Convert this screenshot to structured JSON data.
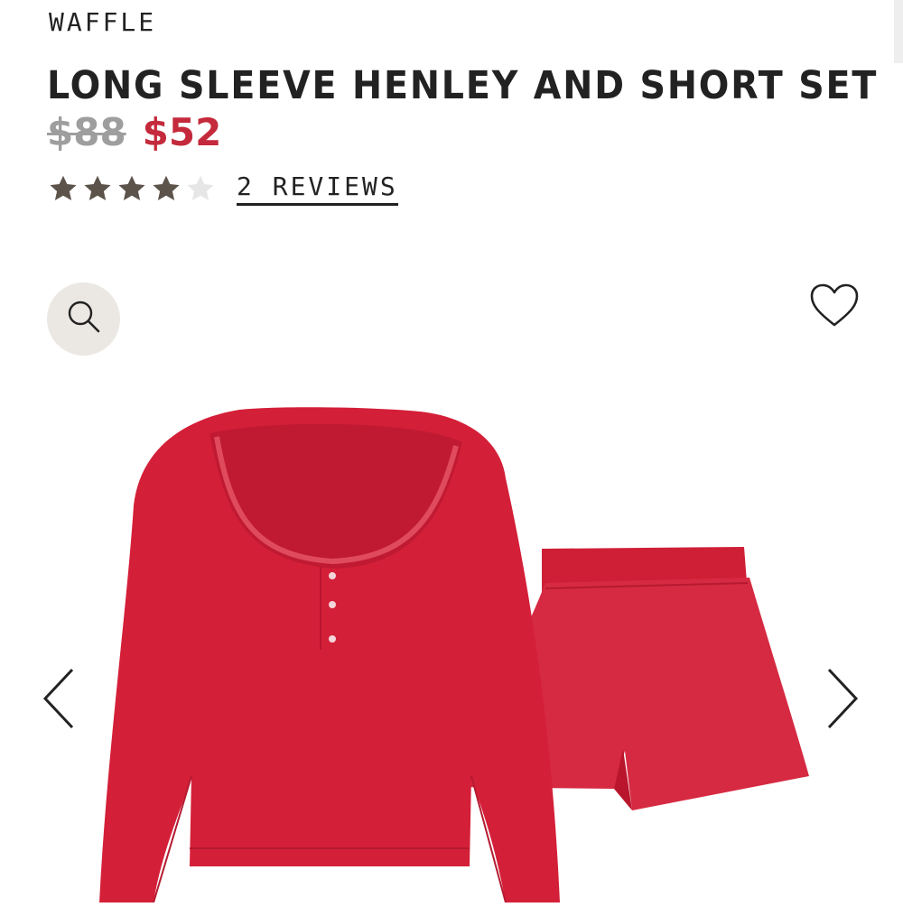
{
  "product": {
    "collection": "WAFFLE",
    "title": "LONG SLEEVE HENLEY AND SHORT SET",
    "price_original": "$88",
    "price_sale": "$52",
    "rating": 4,
    "rating_max": 5,
    "reviews_label": "2 REVIEWS"
  },
  "image": {
    "description_icons": {
      "zoom": "magnifier-icon",
      "wishlist": "heart-outline-icon",
      "prev": "chevron-left-icon",
      "next": "chevron-right-icon"
    }
  },
  "colors": {
    "sale_price": "#c42a3c",
    "original_price": "#9e9e9e",
    "star_filled": "#5c534b",
    "star_empty": "#e6e6e6",
    "zoom_bg": "#ebe8e3",
    "garment": "#d4203a"
  }
}
